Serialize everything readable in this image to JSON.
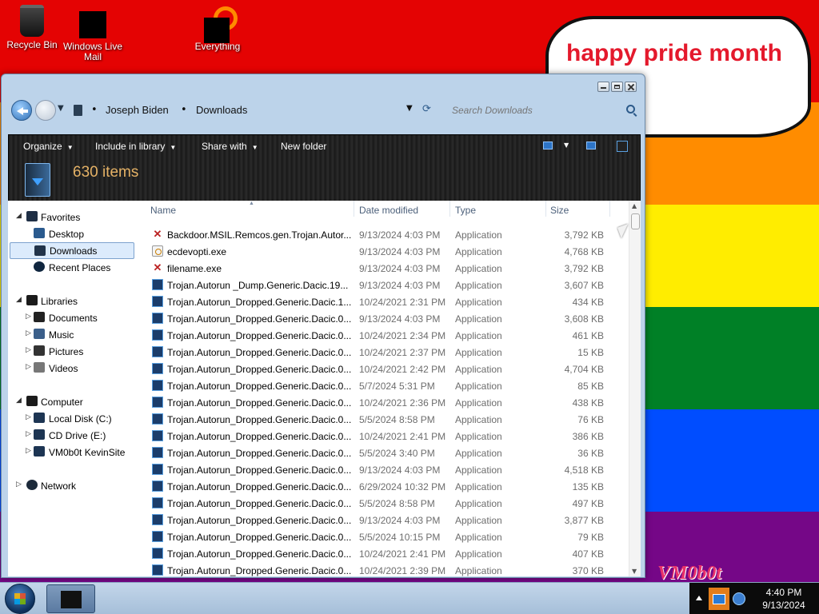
{
  "desktop": {
    "icons": [
      {
        "label": "Recycle Bin",
        "icon": "recycle-bin-icon"
      },
      {
        "label": "Windows Live Mail",
        "icon": "windows-live-mail-icon"
      },
      {
        "label": "Everything",
        "icon": "everything-search-icon"
      }
    ],
    "bubble_text": "happy pride month\nme!",
    "watermark": "VM0b0t",
    "colors": {
      "red": "#e40303",
      "orange": "#ff8c00",
      "yellow": "#ffed00",
      "green": "#008026",
      "blue": "#004dff",
      "violet": "#750787"
    }
  },
  "window": {
    "breadcrumb": [
      "Joseph Biden",
      "Downloads"
    ],
    "search_placeholder": "Search Downloads",
    "commands": {
      "organize": "Organize",
      "include_in_library": "Include in library",
      "share_with": "Share with",
      "new_folder": "New folder"
    },
    "item_count": "630 items",
    "columns": {
      "name": "Name",
      "date": "Date modified",
      "type": "Type",
      "size": "Size"
    }
  },
  "navpane": {
    "favorites": {
      "label": "Favorites",
      "items": [
        "Desktop",
        "Downloads",
        "Recent Places"
      ],
      "selected": "Downloads"
    },
    "libraries": {
      "label": "Libraries",
      "items": [
        "Documents",
        "Music",
        "Pictures",
        "Videos"
      ]
    },
    "computer": {
      "label": "Computer",
      "items": [
        "Local Disk (C:)",
        "CD Drive (E:)",
        "VM0b0t KevinSite"
      ]
    },
    "network": {
      "label": "Network"
    }
  },
  "files": [
    {
      "name": "Backdoor.MSIL.Remcos.gen.Trojan.Autor...",
      "date": "9/13/2024 4:03 PM",
      "type": "Application",
      "size": "3,792 KB",
      "icon": "bug"
    },
    {
      "name": "ecdevopti.exe",
      "date": "9/13/2024 4:03 PM",
      "type": "Application",
      "size": "4,768 KB",
      "icon": "gear"
    },
    {
      "name": "filename.exe",
      "date": "9/13/2024 4:03 PM",
      "type": "Application",
      "size": "3,792 KB",
      "icon": "bug"
    },
    {
      "name": "Trojan.Autorun _Dump.Generic.Dacic.19...",
      "date": "9/13/2024 4:03 PM",
      "type": "Application",
      "size": "3,607 KB",
      "icon": "app"
    },
    {
      "name": "Trojan.Autorun_Dropped.Generic.Dacic.1...",
      "date": "10/24/2021 2:31 PM",
      "type": "Application",
      "size": "434 KB",
      "icon": "app"
    },
    {
      "name": "Trojan.Autorun_Dropped.Generic.Dacic.0...",
      "date": "9/13/2024 4:03 PM",
      "type": "Application",
      "size": "3,608 KB",
      "icon": "app"
    },
    {
      "name": "Trojan.Autorun_Dropped.Generic.Dacic.0...",
      "date": "10/24/2021 2:34 PM",
      "type": "Application",
      "size": "461 KB",
      "icon": "app"
    },
    {
      "name": "Trojan.Autorun_Dropped.Generic.Dacic.0...",
      "date": "10/24/2021 2:37 PM",
      "type": "Application",
      "size": "15 KB",
      "icon": "app"
    },
    {
      "name": "Trojan.Autorun_Dropped.Generic.Dacic.0...",
      "date": "10/24/2021 2:42 PM",
      "type": "Application",
      "size": "4,704 KB",
      "icon": "app"
    },
    {
      "name": "Trojan.Autorun_Dropped.Generic.Dacic.0...",
      "date": "5/7/2024 5:31 PM",
      "type": "Application",
      "size": "85 KB",
      "icon": "app"
    },
    {
      "name": "Trojan.Autorun_Dropped.Generic.Dacic.0...",
      "date": "10/24/2021 2:36 PM",
      "type": "Application",
      "size": "438 KB",
      "icon": "app"
    },
    {
      "name": "Trojan.Autorun_Dropped.Generic.Dacic.0...",
      "date": "5/5/2024 8:58 PM",
      "type": "Application",
      "size": "76 KB",
      "icon": "app"
    },
    {
      "name": "Trojan.Autorun_Dropped.Generic.Dacic.0...",
      "date": "10/24/2021 2:41 PM",
      "type": "Application",
      "size": "386 KB",
      "icon": "app"
    },
    {
      "name": "Trojan.Autorun_Dropped.Generic.Dacic.0...",
      "date": "5/5/2024 3:40 PM",
      "type": "Application",
      "size": "36 KB",
      "icon": "app"
    },
    {
      "name": "Trojan.Autorun_Dropped.Generic.Dacic.0...",
      "date": "9/13/2024 4:03 PM",
      "type": "Application",
      "size": "4,518 KB",
      "icon": "app"
    },
    {
      "name": "Trojan.Autorun_Dropped.Generic.Dacic.0...",
      "date": "6/29/2024 10:32 PM",
      "type": "Application",
      "size": "135 KB",
      "icon": "app"
    },
    {
      "name": "Trojan.Autorun_Dropped.Generic.Dacic.0...",
      "date": "5/5/2024 8:58 PM",
      "type": "Application",
      "size": "497 KB",
      "icon": "app"
    },
    {
      "name": "Trojan.Autorun_Dropped.Generic.Dacic.0...",
      "date": "9/13/2024 4:03 PM",
      "type": "Application",
      "size": "3,877 KB",
      "icon": "app"
    },
    {
      "name": "Trojan.Autorun_Dropped.Generic.Dacic.0...",
      "date": "5/5/2024 10:15 PM",
      "type": "Application",
      "size": "79 KB",
      "icon": "app"
    },
    {
      "name": "Trojan.Autorun_Dropped.Generic.Dacic.0...",
      "date": "10/24/2021 2:41 PM",
      "type": "Application",
      "size": "407 KB",
      "icon": "app"
    },
    {
      "name": "Trojan.Autorun_Dropped.Generic.Dacic.0...",
      "date": "10/24/2021 2:39 PM",
      "type": "Application",
      "size": "370 KB",
      "icon": "app"
    }
  ],
  "taskbar": {
    "time": "4:40 PM",
    "date": "9/13/2024"
  }
}
